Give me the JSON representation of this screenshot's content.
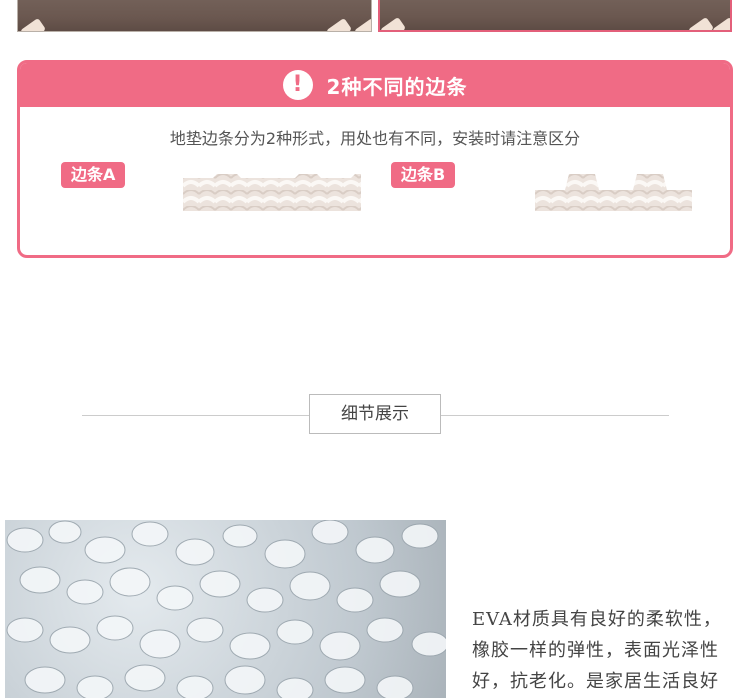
{
  "edge_section": {
    "title": "2种不同的边条",
    "alert_glyph": "!",
    "description": "地垫边条分为2种形式，用处也有不同，安装时请注意区分",
    "tag_a": "边条A",
    "tag_b": "边条B",
    "accent_color": "#f06b85"
  },
  "detail_section": {
    "title": "细节展示"
  },
  "material": {
    "lines": [
      "EVA材质具有良好的柔软性，",
      "橡胶一样的弹性，表面光泽性",
      "好，抗老化。是家居生活良好"
    ]
  }
}
